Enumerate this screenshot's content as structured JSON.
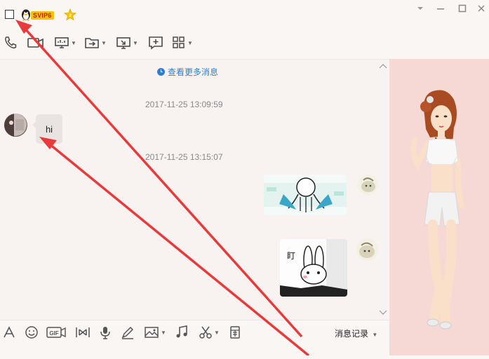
{
  "title_bar": {
    "vip_badge": "SVIP6",
    "icons": [
      "checkbox-icon",
      "qq-penguin-icon",
      "star-badge-icon"
    ],
    "window_buttons": [
      "dropdown-icon",
      "minimize-icon",
      "maximize-icon",
      "close-icon"
    ]
  },
  "toolbar": {
    "items": [
      "phone-icon",
      "video-call-icon",
      "screen-share-icon",
      "file-transfer-icon",
      "remote-desktop-icon",
      "new-chat-icon",
      "apps-icon"
    ]
  },
  "chat": {
    "more_messages": "查看更多消息",
    "messages": [
      {
        "timestamp": "2017-11-25 13:09:59",
        "from": "other",
        "text": "hi"
      },
      {
        "timestamp": "2017-11-25 13:15:07",
        "from": "me",
        "type": "sticker",
        "sticker_text": ""
      },
      {
        "from": "me",
        "type": "sticker",
        "sticker_text": "盯"
      }
    ]
  },
  "input_toolbar": {
    "items": [
      "font-icon",
      "emoji-icon",
      "gif-icon",
      "screenshot-icon",
      "voice-icon",
      "doodle-icon",
      "image-icon",
      "music-icon",
      "scissors-icon",
      "red-packet-icon"
    ],
    "gif_label": "GIF",
    "record_label": "消息记录"
  },
  "colors": {
    "accent": "#2e7fd0",
    "sidebar_bg": "#f6d9d4",
    "arrow": "#e83a3a"
  }
}
